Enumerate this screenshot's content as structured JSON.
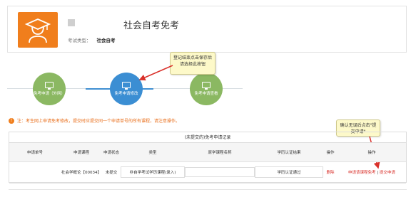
{
  "header": {
    "title": "社会自考免考",
    "exam_type_label": "考试类型：",
    "exam_type_value": "社会自考"
  },
  "steps": [
    {
      "label": "免考申请（外网）",
      "state": "done"
    },
    {
      "label": "免考申请修改",
      "state": "active"
    },
    {
      "label": "免考申请查看",
      "state": "done"
    }
  ],
  "callouts": {
    "save_tip": "登记结束点击保存后请选择此按钮",
    "submit_tip": "确认无误后点击\"提交申请\""
  },
  "notice": "注：考生网上申请免考修改，提交时应提交同一个申请单号的所有课程，请注意操作。",
  "table": {
    "title": "(未提交的)免考申请记录",
    "columns": [
      "申请单号",
      "申请课程",
      "申请状态",
      "类型",
      "原学课程名称",
      "学历认证结果",
      "操作",
      "操作"
    ],
    "rows": [
      {
        "id": "",
        "course": "社会学概论【00034】",
        "status": "未提交",
        "type": "非自学考试学历课程(录入)",
        "original_course": "",
        "auth_result": "学历认证通过",
        "action_delete": "删除",
        "action_apply": "申请该课程免考",
        "action_sep": "|",
        "action_submit": "提交申请"
      }
    ]
  },
  "colors": {
    "accent_orange": "#f07e1c",
    "step_green": "#8bb862",
    "step_blue": "#3b8ed3",
    "link_red": "#d9312b"
  }
}
